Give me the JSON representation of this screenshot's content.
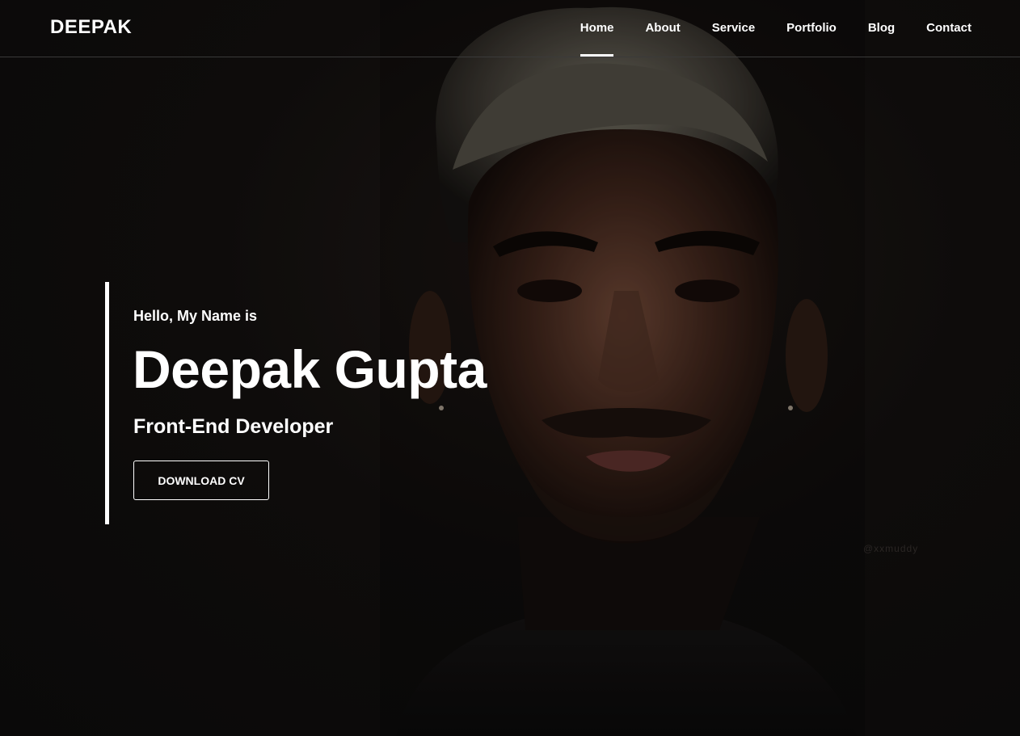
{
  "brand": {
    "logo": "DEEPAK"
  },
  "nav": {
    "items": [
      {
        "label": "Home",
        "active": true
      },
      {
        "label": "About",
        "active": false
      },
      {
        "label": "Service",
        "active": false
      },
      {
        "label": "Portfolio",
        "active": false
      },
      {
        "label": "Blog",
        "active": false
      },
      {
        "label": "Contact",
        "active": false
      }
    ]
  },
  "hero": {
    "greeting": "Hello, My Name is",
    "name": "Deepak Gupta",
    "role": "Front-End Developer",
    "cv_button": "DOWNLOAD CV",
    "watermark": "@xxmuddy"
  },
  "colors": {
    "background": "#0b0a0a",
    "text": "#ffffff",
    "divider": "#3a3a3a"
  }
}
